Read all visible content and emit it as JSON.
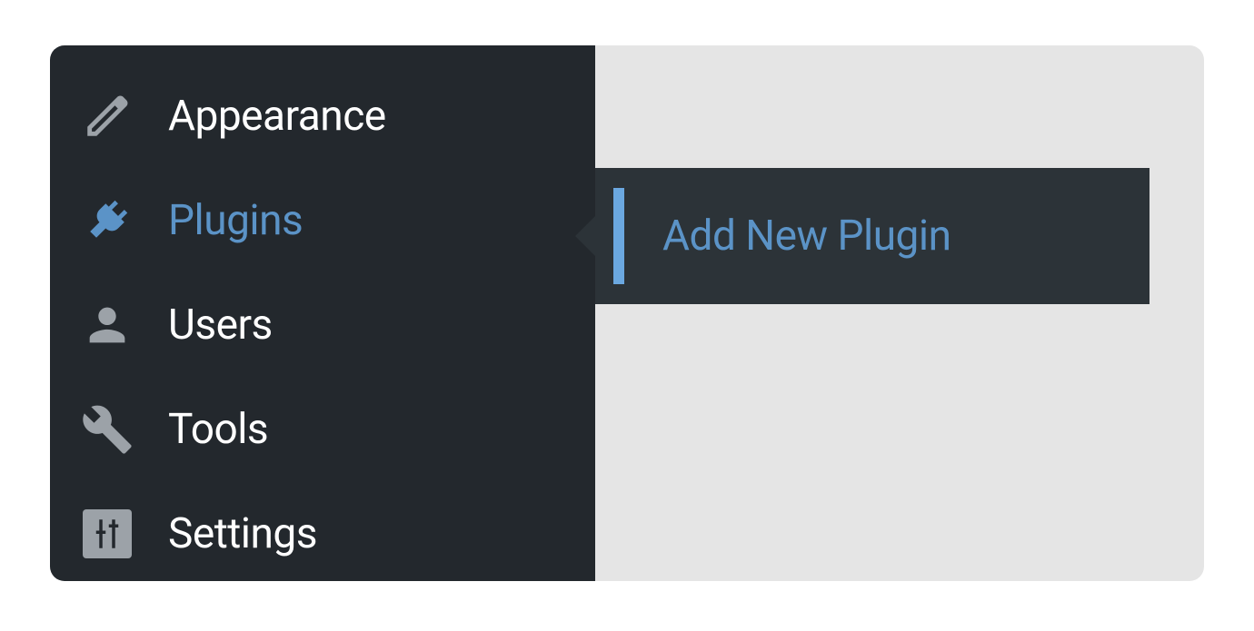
{
  "sidebar": {
    "items": [
      {
        "label": "Appearance",
        "icon": "brush",
        "active": false
      },
      {
        "label": "Plugins",
        "icon": "plug",
        "active": true
      },
      {
        "label": "Users",
        "icon": "user",
        "active": false
      },
      {
        "label": "Tools",
        "icon": "wrench",
        "active": false
      },
      {
        "label": "Settings",
        "icon": "sliders",
        "active": false
      }
    ]
  },
  "flyout": {
    "label": "Add New Plugin"
  },
  "colors": {
    "sidebar_bg": "#23282d",
    "flyout_bg": "#2c3338",
    "active": "#5b93c7",
    "inactive_icon": "#9ca2a8",
    "text": "#ffffff",
    "page_bg": "#e5e5e5"
  }
}
